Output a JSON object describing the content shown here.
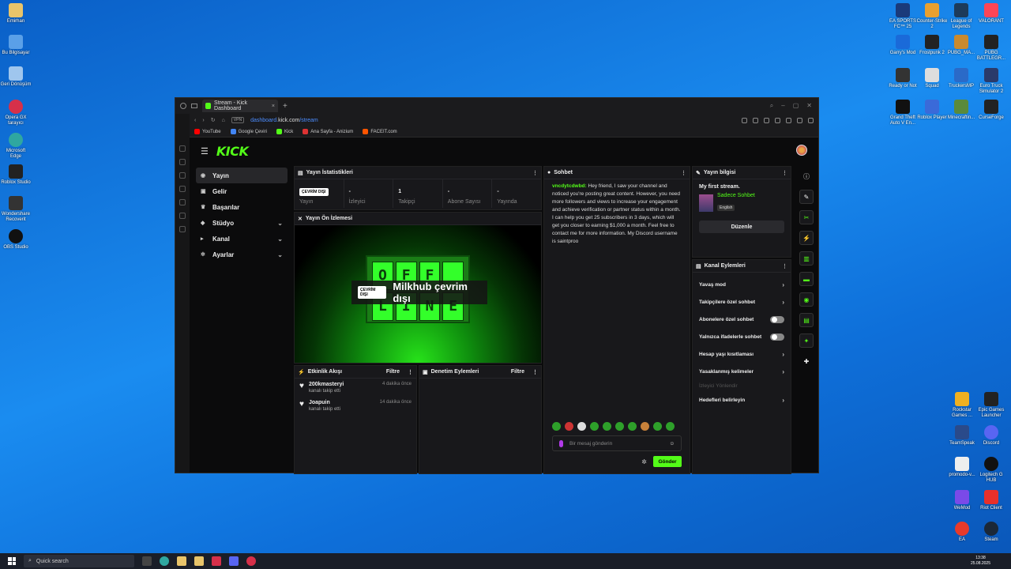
{
  "desktop": {
    "left_icons": [
      "Emirhan",
      "Bu Bilgisayar",
      "Geri Dönüşüm",
      "Opera GX tarayıcı",
      "Microsoft Edge",
      "Roblox Studio",
      "Wondershare Recoverit",
      "OBS Studio"
    ],
    "right_icons": [
      "EA SPORTS FC™ 25",
      "Counter-Strike 2",
      "League of Legends",
      "VALORANT",
      "Garry's Mod",
      "Frostpunk 2",
      "PUBG_MA...",
      "PUBG BATTLEGR...",
      "Ready or Not",
      "Squad",
      "TruckersMP",
      "Euro Truck Simulator 2",
      "Grand Theft Auto V En...",
      "Roblox Player",
      "Minecraftin...",
      "CurseForge"
    ],
    "right_bottom_icons": [
      "Rockstar Games ...",
      "Epic Games Launcher",
      "TeamSpeak",
      "Discord",
      "promodo-v...",
      "Logitech G HUB",
      "WeMod",
      "Riot Client",
      "EA",
      "Steam"
    ]
  },
  "browser": {
    "tab_title": "Stream - Kick Dashboard",
    "url_prefix": "dashboard.",
    "url_host": "kick.com",
    "url_path": "/stream",
    "vpn_label": "VPN",
    "bookmarks": [
      "YouTube",
      "Google Çeviri",
      "Kick",
      "Ana Sayfa - Anizium",
      "FACEIT.com"
    ]
  },
  "kick": {
    "logo": "KICK",
    "nav": [
      {
        "label": "Yayın"
      },
      {
        "label": "Gelir"
      },
      {
        "label": "Başarılar"
      },
      {
        "label": "Stüdyo"
      },
      {
        "label": "Kanal"
      },
      {
        "label": "Ayarlar"
      }
    ],
    "stats": {
      "title": "Yayın İstatistikleri",
      "offline_badge": "ÇEVRİM DIŞI",
      "items": [
        {
          "value": "",
          "label": "Yayın"
        },
        {
          "value": "-",
          "label": "İzleyici"
        },
        {
          "value": "1",
          "label": "Takipçi"
        },
        {
          "value": "-",
          "label": "Abone Sayısı"
        },
        {
          "value": "-",
          "label": "Yayında"
        }
      ]
    },
    "preview": {
      "title": "Yayın Ön İzlemesi",
      "sign_letters": [
        "O",
        "F",
        "F",
        "",
        "L",
        "I",
        "N",
        "E"
      ],
      "offline_badge": "ÇEVRİM DIŞI",
      "offline_text": "Milkhub çevrim dışı"
    },
    "activity": {
      "title": "Etkinlik Akışı",
      "filter": "Filtre",
      "items": [
        {
          "name": "200kmasteryi",
          "sub": "kanalı takip etti",
          "time": "4 dakika önce"
        },
        {
          "name": "Joapuin",
          "sub": "kanalı takip etti",
          "time": "14 dakika önce"
        }
      ]
    },
    "moderation": {
      "title": "Denetim Eylemleri",
      "filter": "Filtre"
    },
    "chat": {
      "title": "Sohbet",
      "user": "vncdytcdwbd:",
      "message": "Hey friend, I saw your channel and noticed you're posting great content. However, you need more followers and views to increase your engagement and achieve verification or partner status within a month. I can help you get 25 subscribers in 3 days, which will get you closer to earning $1,000 a month. Feel free to contact me for more information. My Discord username is saintproo",
      "placeholder": "Bir mesaj gönderin",
      "send": "Gönder"
    },
    "stream_info": {
      "title": "Yayın bilgisi",
      "stream_title": "My first stream.",
      "category": "Sadece Sohbet",
      "language": "English",
      "edit": "Düzenle"
    },
    "channel_actions": {
      "title": "Kanal Eylemleri",
      "items": [
        {
          "label": "Yavaş mod",
          "kind": "chevron"
        },
        {
          "label": "Takipçilere özel sohbet",
          "kind": "chevron"
        },
        {
          "label": "Abonelere özel sohbet",
          "kind": "toggle"
        },
        {
          "label": "Yalnızca ifadelerle sohbet",
          "kind": "toggle"
        },
        {
          "label": "Hesap yaşı kısıtlaması",
          "kind": "chevron"
        },
        {
          "label": "Yasaklanmış kelimeler",
          "kind": "chevron"
        },
        {
          "label": "İzleyici Yönlendir",
          "kind": "muted"
        },
        {
          "label": "Hedefleri belirleyin",
          "kind": "chevron"
        }
      ]
    }
  },
  "taskbar": {
    "search": "Quick search",
    "time": "13:38",
    "date": "25.08.2025"
  }
}
